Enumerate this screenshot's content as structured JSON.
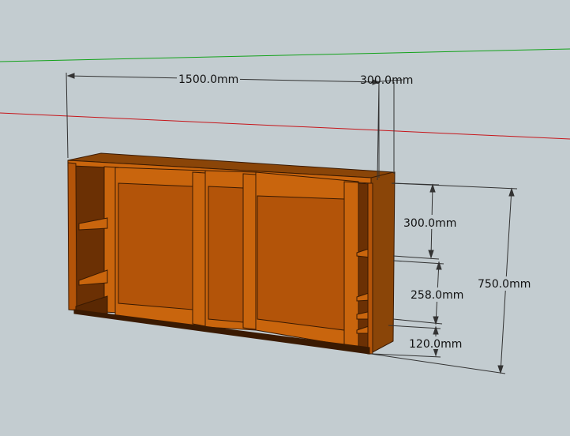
{
  "scene": {
    "axis_colors": {
      "green": "#13a21b",
      "red": "#c6161b"
    },
    "background": "#c3ccd0",
    "wood_colors": {
      "front": "#b35409",
      "edge": "#c9650d",
      "top": "#8a4508",
      "inside": "#6b3004",
      "shadow": "#3a1a02"
    }
  },
  "dimensions": {
    "width": "1500.0mm",
    "depth": "300.0mm",
    "height": "750.0mm",
    "section_top": "300.0mm",
    "section_middle": "258.0mm",
    "section_bottom": "120.0mm"
  }
}
